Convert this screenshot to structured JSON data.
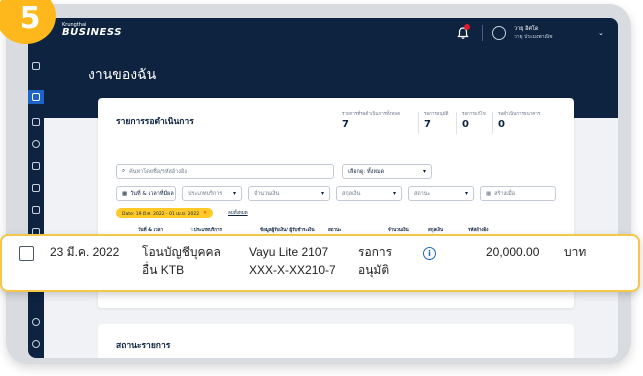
{
  "step_badge": "5",
  "app": {
    "brand": "BUSINESS",
    "brand_small": "Krungthai"
  },
  "user": {
    "name": "วายุ อิศโด",
    "role": "วายุ ประมงพาณิช"
  },
  "page": {
    "title": "งานของฉัน"
  },
  "pending": {
    "title": "รายการรอดำเนินการ",
    "stats": [
      {
        "label": "รายการที่รอดำเนินการทั้งหมด",
        "value": "7"
      },
      {
        "label": "รอการอนุมัติ",
        "value": "7"
      },
      {
        "label": "รอการแก้ไข",
        "value": "0"
      },
      {
        "label": "รอดำเนินการธนาคาร",
        "value": "0"
      }
    ]
  },
  "filters": {
    "search_placeholder": "ค้นหาโดยชื่อ/รหัสอ้างอิง",
    "account_select": "เลือกดู: ทั้งหมด",
    "date_button": "วันที่ & เวลาที่มีผล",
    "service_type": "ประเภทบริการ",
    "amount": "จำนวนเงิน",
    "currency": "สกุลเงิน",
    "status": "สถานะ",
    "created": "สร้างเมื่อ"
  },
  "active_filter": {
    "chip": "Date: 19 มี.ค. 2022 - 01 เม.ย. 2022",
    "clear_all": "ลบทั้งหมด"
  },
  "table_headers": [
    "วันที่ & เวลา",
    "ประเภทบริการ",
    "ข้อมูลผู้รับเงิน/ ผู้รับชำระเงิน",
    "สถานะ",
    "จำนวนเงิน",
    "สกุลเงิน",
    "รหัสอ้างอิง"
  ],
  "highlight_row": {
    "date": "23 มี.ค. 2022",
    "service_line1": "โอนบัญชีบุคคล",
    "service_line2": "อื่น KTB",
    "payee_line1": "Vayu Lite 2107",
    "payee_line2": "XXX-X-XX210-7",
    "status_line1": "รอการ",
    "status_line2": "อนุมัติ",
    "amount": "20,000.00",
    "currency": "บาท"
  },
  "status_card": {
    "title": "สถานะรายการ"
  },
  "icons": [
    "bell-icon",
    "user-icon",
    "search-icon",
    "calendar-icon",
    "info-icon",
    "chevron-down-icon"
  ],
  "colors": {
    "navy": "#0d2340",
    "accent_yellow": "#ffb81c",
    "highlight_border": "#f3c747",
    "blue": "#1e63c8",
    "alert_red": "#e0182d"
  }
}
